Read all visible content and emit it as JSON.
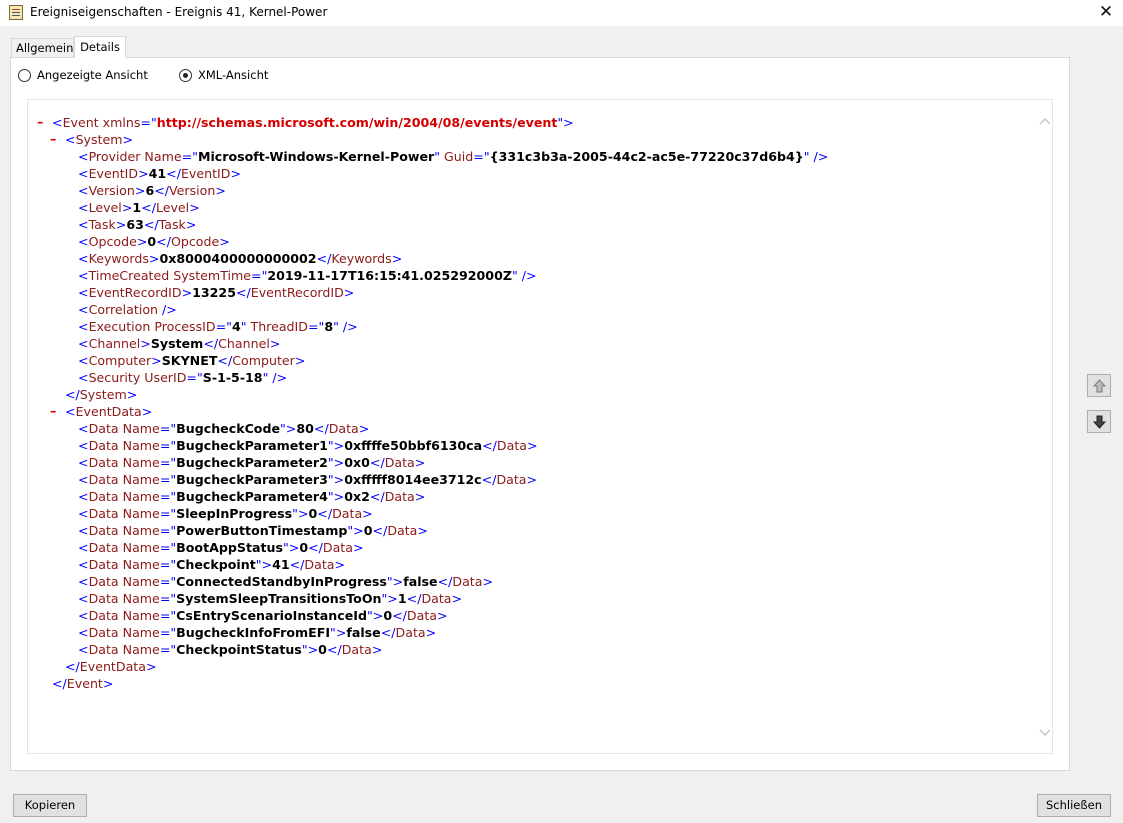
{
  "window": {
    "title": "Ereigniseigenschaften - Ereignis 41, Kernel-Power",
    "close_glyph": "✕"
  },
  "tabs": [
    {
      "label": "Allgemein",
      "selected": false
    },
    {
      "label": "Details",
      "selected": true
    }
  ],
  "view_options": {
    "friendly": {
      "label": "Angezeigte Ansicht",
      "checked": false
    },
    "xml": {
      "label": "XML-Ansicht",
      "checked": true
    }
  },
  "xml": {
    "event_open_prefix": "<Event xmlns=\"",
    "namespace": "http://schemas.microsoft.com/win/2004/08/events/event",
    "event_open_suffix": "\">",
    "system_open": "<System>",
    "system_close": "</System>",
    "eventdata_open": "<EventData>",
    "eventdata_close": "</EventData>",
    "event_close": "</Event>",
    "collapse_glyph": "–",
    "provider": {
      "name": "Microsoft-Windows-Kernel-Power",
      "guid": "{331c3b3a-2005-44c2-ac5e-77220c37d6b4}"
    },
    "system_fields": [
      {
        "tag": "EventID",
        "value": "41"
      },
      {
        "tag": "Version",
        "value": "6"
      },
      {
        "tag": "Level",
        "value": "1"
      },
      {
        "tag": "Task",
        "value": "63"
      },
      {
        "tag": "Opcode",
        "value": "0"
      },
      {
        "tag": "Keywords",
        "value": "0x8000400000000002"
      }
    ],
    "time_created": "2019-11-17T16:15:41.025292000Z",
    "event_record_id": "13225",
    "execution": {
      "process_id": "4",
      "thread_id": "8"
    },
    "channel": "System",
    "computer": "SKYNET",
    "security_user_id": "S-1-5-18",
    "data_items": [
      {
        "name": "BugcheckCode",
        "value": "80"
      },
      {
        "name": "BugcheckParameter1",
        "value": "0xffffe50bbf6130ca"
      },
      {
        "name": "BugcheckParameter2",
        "value": "0x0"
      },
      {
        "name": "BugcheckParameter3",
        "value": "0xfffff8014ee3712c"
      },
      {
        "name": "BugcheckParameter4",
        "value": "0x2"
      },
      {
        "name": "SleepInProgress",
        "value": "0"
      },
      {
        "name": "PowerButtonTimestamp",
        "value": "0"
      },
      {
        "name": "BootAppStatus",
        "value": "0"
      },
      {
        "name": "Checkpoint",
        "value": "41"
      },
      {
        "name": "ConnectedStandbyInProgress",
        "value": "false"
      },
      {
        "name": "SystemSleepTransitionsToOn",
        "value": "1"
      },
      {
        "name": "CsEntryScenarioInstanceId",
        "value": "0"
      },
      {
        "name": "BugcheckInfoFromEFI",
        "value": "false"
      },
      {
        "name": "CheckpointStatus",
        "value": "0"
      }
    ]
  },
  "buttons": {
    "copy": "Kopieren",
    "close": "Schließen"
  },
  "icons": {
    "app": "event-viewer-icon",
    "scroll_up": "chevron-up-icon",
    "scroll_down": "chevron-down-icon",
    "prev": "arrow-up-icon",
    "next": "arrow-down-icon"
  }
}
